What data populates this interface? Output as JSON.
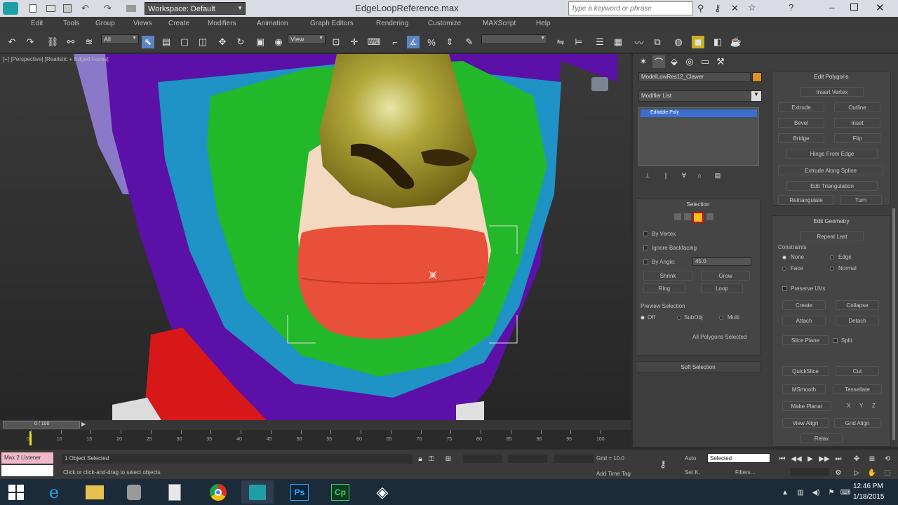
{
  "titlebar": {
    "workspace": "Workspace: Default",
    "filename": "EdgeLoopReference.max",
    "search_placeholder": "Type a keyword or phrase"
  },
  "menu": [
    "Edit",
    "Tools",
    "Group",
    "Views",
    "Create",
    "Modifiers",
    "Animation",
    "Graph Editors",
    "Rendering",
    "Customize",
    "MAXScript",
    "Help"
  ],
  "toolbar": {
    "filter": "All",
    "refcoord": "View"
  },
  "viewport": {
    "label": "[+] [Perspective] [Realistic + Edged Faces]"
  },
  "cmdpanel": {
    "object_name": "ModelLowRes12_Clawer",
    "modifier_list": "Modifier List",
    "stack_item": "Editable Poly",
    "selection_title": "Selection",
    "by_vertex": "By Vertex",
    "ignore_backfacing": "Ignore Backfacing",
    "by_angle": "By Angle:",
    "angle_value": "45.0",
    "shrink": "Shrink",
    "grow": "Grow",
    "ring": "Ring",
    "loop": "Loop",
    "preview_selection": "Preview Selection",
    "off": "Off",
    "subobj": "SubObj",
    "multi": "Multi",
    "selected_info": "All Polygons Selected",
    "soft_selection": "Soft Selection",
    "edit_polygons": "Edit Polygons",
    "insert_vertex": "Insert Vertex",
    "extrude": "Extrude",
    "outline": "Outline",
    "bevel": "Bevel",
    "inset": "Inset",
    "bridge": "Bridge",
    "flip": "Flip",
    "hinge": "Hinge From Edge",
    "extrude_spline": "Extrude Along Spline",
    "edit_tri": "Edit Triangulation",
    "retriangulate": "Retriangulate",
    "turn": "Turn",
    "edit_geometry": "Edit Geometry",
    "repeat_last": "Repeat Last",
    "constraints": "Constraints",
    "none": "None",
    "edge": "Edge",
    "face": "Face",
    "normal": "Normal",
    "preserve_uvs": "Preserve UVs",
    "create": "Create",
    "collapse": "Collapse",
    "attach": "Attach",
    "detach": "Detach",
    "slice_plane": "Slice Plane",
    "split": "Split",
    "quickslice": "QuickSlice",
    "cut": "Cut",
    "msmooth": "MSmooth",
    "tessellate": "Tessellate",
    "make_planar": "Make Planar",
    "xyz": [
      "X",
      "Y",
      "Z"
    ],
    "view_align": "View Align",
    "grid_align": "Grid Align",
    "relax": "Relax"
  },
  "timeslider": {
    "frame": "0 / 100"
  },
  "ticks": [
    "0",
    "10",
    "15",
    "20",
    "25",
    "30",
    "35",
    "40",
    "45",
    "50",
    "55",
    "60",
    "65",
    "70",
    "75",
    "80",
    "85",
    "90",
    "95",
    "100"
  ],
  "status": {
    "script_label": "Max 2 Listener",
    "selected": "1 Object Selected",
    "prompt": "Click or click-and-drag to select objects",
    "grid": "Grid = 10.0",
    "add_time_tag": "Add Time Tag",
    "auto": "Auto",
    "set": "Set K.",
    "selected_dd": "Selected",
    "filters": "Filters..."
  },
  "taskbar": {
    "time": "12:46 PM",
    "date": "1/18/2015",
    "apps": [
      "windows-start",
      "internet-explorer",
      "file-explorer",
      "control-panel",
      "notepad",
      "chrome",
      "3ds-max",
      "photoshop",
      "captivate",
      "unity"
    ]
  },
  "colors": {
    "face_purple": "#5b10a8",
    "face_cyan": "#1f93c5",
    "face_green": "#22b82a",
    "nose_olive": "#a79b2a",
    "skin": "#f3d9c0",
    "lips": "#e8503a",
    "neck_red": "#d81818"
  }
}
